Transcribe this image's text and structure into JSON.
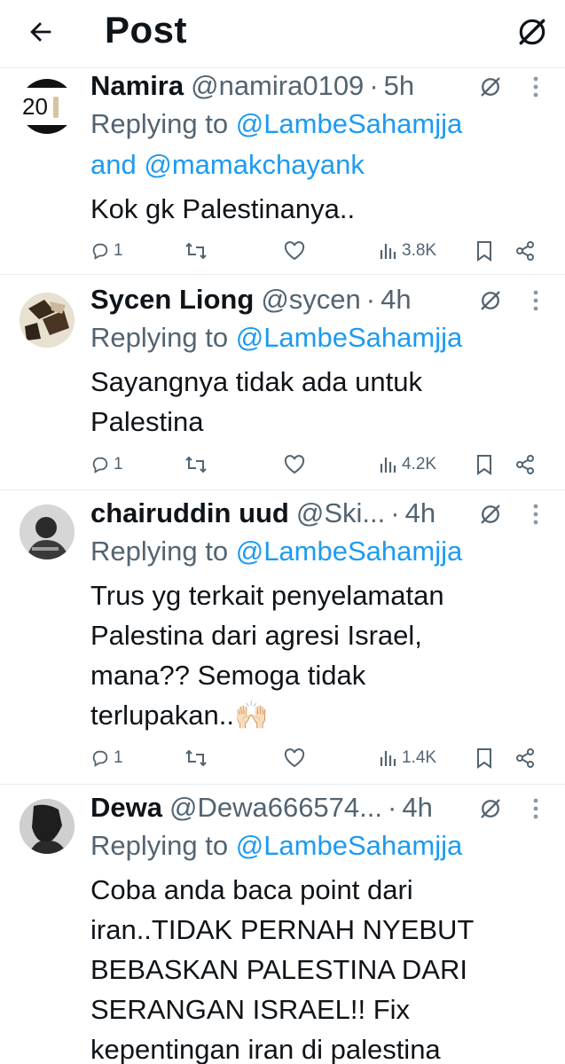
{
  "header": {
    "title": "Post",
    "back_icon": "arrow-left-icon",
    "grok_icon": "grok-icon"
  },
  "colors": {
    "mention": "#1d9bf0",
    "secondary": "#536471",
    "text": "#0f1419",
    "divider": "#e6ecf0"
  },
  "replies": [
    {
      "name": "Namira",
      "handle": "@namira0109",
      "dot": "·",
      "time": "5h",
      "replying_prefix": "Replying to ",
      "mentions": [
        "@LambeSahamjja",
        "@mamakchayank"
      ],
      "mention_joiner": "and ",
      "body": "Kok gk Palestinanya..",
      "reply_count": "1",
      "views": "3.8K"
    },
    {
      "name": "Sycen Liong",
      "handle": "@sycen",
      "dot": "·",
      "time": "4h",
      "replying_prefix": "Replying to ",
      "mentions": [
        "@LambeSahamjja"
      ],
      "body": "Sayangnya tidak ada untuk\nPalestina",
      "reply_count": "1",
      "views": "4.2K"
    },
    {
      "name": "chairuddin uud",
      "handle": "@Ski...",
      "dot": "·",
      "time": "4h",
      "replying_prefix": "Replying to ",
      "mentions": [
        "@LambeSahamjja"
      ],
      "body": "Trus yg terkait penyelamatan\nPalestina dari agresi Israel,\nmana?? Semoga tidak\nterlupakan..🙌🏻",
      "reply_count": "1",
      "views": "1.4K"
    },
    {
      "name": "Dewa",
      "handle": "@Dewa666574...",
      "dot": "·",
      "time": "4h",
      "replying_prefix": "Replying to ",
      "mentions": [
        "@LambeSahamjja"
      ],
      "body": "Coba anda baca point dari\niran..TIDAK PERNAH NYEBUT\nBEBASKAN PALESTINA DARI\nSERANGAN ISRAEL!! Fix\nkepentingan iran di palestina"
    }
  ],
  "avatar_text_namira": "20"
}
